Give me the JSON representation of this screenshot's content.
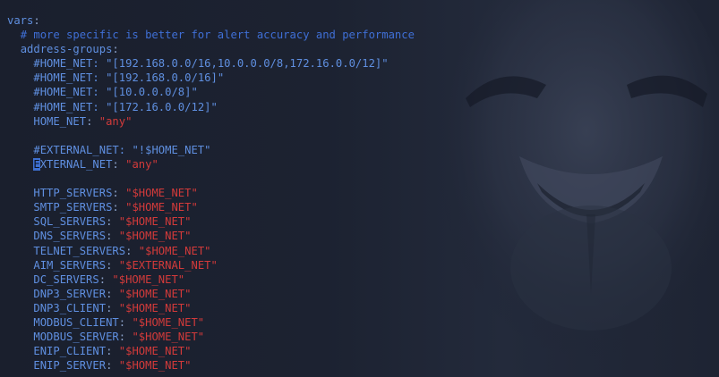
{
  "editor": {
    "lines": [
      {
        "indent": "",
        "key": "vars",
        "sep": ":",
        "value": "",
        "comment": ""
      },
      {
        "indent": "  ",
        "key": "",
        "sep": "",
        "value": "",
        "comment": "# more specific is better for alert accuracy and performance"
      },
      {
        "indent": "  ",
        "key": "address-groups",
        "sep": ":",
        "value": "",
        "comment": ""
      },
      {
        "indent": "    ",
        "key": "#HOME_NET",
        "sep": ": ",
        "value": "\"[192.168.0.0/16,10.0.0.0/8,172.16.0.0/12]\"",
        "comment": "",
        "value_commented": true
      },
      {
        "indent": "    ",
        "key": "#HOME_NET",
        "sep": ": ",
        "value": "\"[192.168.0.0/16]\"",
        "comment": "",
        "value_commented": true
      },
      {
        "indent": "    ",
        "key": "#HOME_NET",
        "sep": ": ",
        "value": "\"[10.0.0.0/8]\"",
        "comment": "",
        "value_commented": true
      },
      {
        "indent": "    ",
        "key": "#HOME_NET",
        "sep": ": ",
        "value": "\"[172.16.0.0/12]\"",
        "comment": "",
        "value_commented": true
      },
      {
        "indent": "    ",
        "key": "HOME_NET",
        "sep": ": ",
        "value": "\"any\"",
        "comment": ""
      },
      {
        "indent": "",
        "key": "",
        "sep": "",
        "value": "",
        "comment": ""
      },
      {
        "indent": "    ",
        "key": "#EXTERNAL_NET",
        "sep": ": ",
        "value": "\"!$HOME_NET\"",
        "comment": "",
        "value_commented": true
      },
      {
        "indent": "    ",
        "key": "EXTERNAL_NET",
        "sep": ": ",
        "value": "\"any\"",
        "comment": "",
        "cursor": true
      },
      {
        "indent": "",
        "key": "",
        "sep": "",
        "value": "",
        "comment": ""
      },
      {
        "indent": "    ",
        "key": "HTTP_SERVERS",
        "sep": ": ",
        "value": "\"$HOME_NET\"",
        "comment": ""
      },
      {
        "indent": "    ",
        "key": "SMTP_SERVERS",
        "sep": ": ",
        "value": "\"$HOME_NET\"",
        "comment": ""
      },
      {
        "indent": "    ",
        "key": "SQL_SERVERS",
        "sep": ": ",
        "value": "\"$HOME_NET\"",
        "comment": ""
      },
      {
        "indent": "    ",
        "key": "DNS_SERVERS",
        "sep": ": ",
        "value": "\"$HOME_NET\"",
        "comment": ""
      },
      {
        "indent": "    ",
        "key": "TELNET_SERVERS",
        "sep": ": ",
        "value": "\"$HOME_NET\"",
        "comment": ""
      },
      {
        "indent": "    ",
        "key": "AIM_SERVERS",
        "sep": ": ",
        "value": "\"$EXTERNAL_NET\"",
        "comment": ""
      },
      {
        "indent": "    ",
        "key": "DC_SERVERS",
        "sep": ": ",
        "value": "\"$HOME_NET\"",
        "comment": ""
      },
      {
        "indent": "    ",
        "key": "DNP3_SERVER",
        "sep": ": ",
        "value": "\"$HOME_NET\"",
        "comment": ""
      },
      {
        "indent": "    ",
        "key": "DNP3_CLIENT",
        "sep": ": ",
        "value": "\"$HOME_NET\"",
        "comment": ""
      },
      {
        "indent": "    ",
        "key": "MODBUS_CLIENT",
        "sep": ": ",
        "value": "\"$HOME_NET\"",
        "comment": ""
      },
      {
        "indent": "    ",
        "key": "MODBUS_SERVER",
        "sep": ": ",
        "value": "\"$HOME_NET\"",
        "comment": ""
      },
      {
        "indent": "    ",
        "key": "ENIP_CLIENT",
        "sep": ": ",
        "value": "\"$HOME_NET\"",
        "comment": ""
      },
      {
        "indent": "    ",
        "key": "ENIP_SERVER",
        "sep": ": ",
        "value": "\"$HOME_NET\"",
        "comment": ""
      }
    ]
  },
  "colors": {
    "background": "#1b2130",
    "key": "#5f8fe0",
    "comment": "#3f6fd6",
    "string": "#d23a3a",
    "cursor": "#3d6fd0"
  },
  "background_image": "guy-fawkes-mask-wallpaper"
}
